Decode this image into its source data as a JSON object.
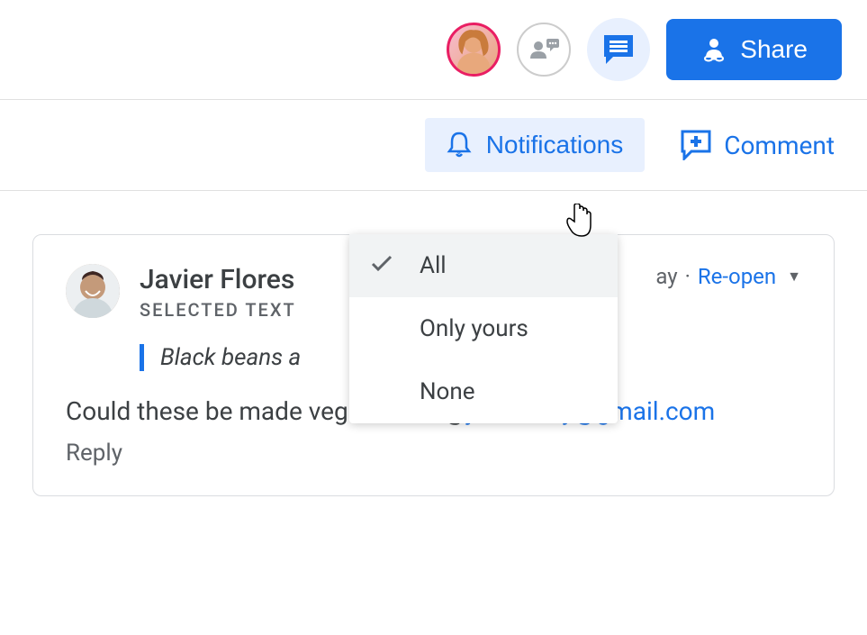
{
  "toolbar": {
    "share_label": "Share"
  },
  "secondary": {
    "notifications_label": "Notifications",
    "comment_label": "Comment"
  },
  "dropdown": {
    "items": [
      "All",
      "Only yours",
      "None"
    ],
    "selected_index": 0
  },
  "comment": {
    "author": "Javier Flores",
    "selected_text_label": "SELECTED TEXT",
    "quoted_text": "Black beans a",
    "body_prefix": "Could these be made vegetarian? @",
    "mention": "juliafillory@gmail.com",
    "timestamp_fragment": "ay",
    "reopen_label": "Re-open",
    "reply_label": "Reply"
  }
}
